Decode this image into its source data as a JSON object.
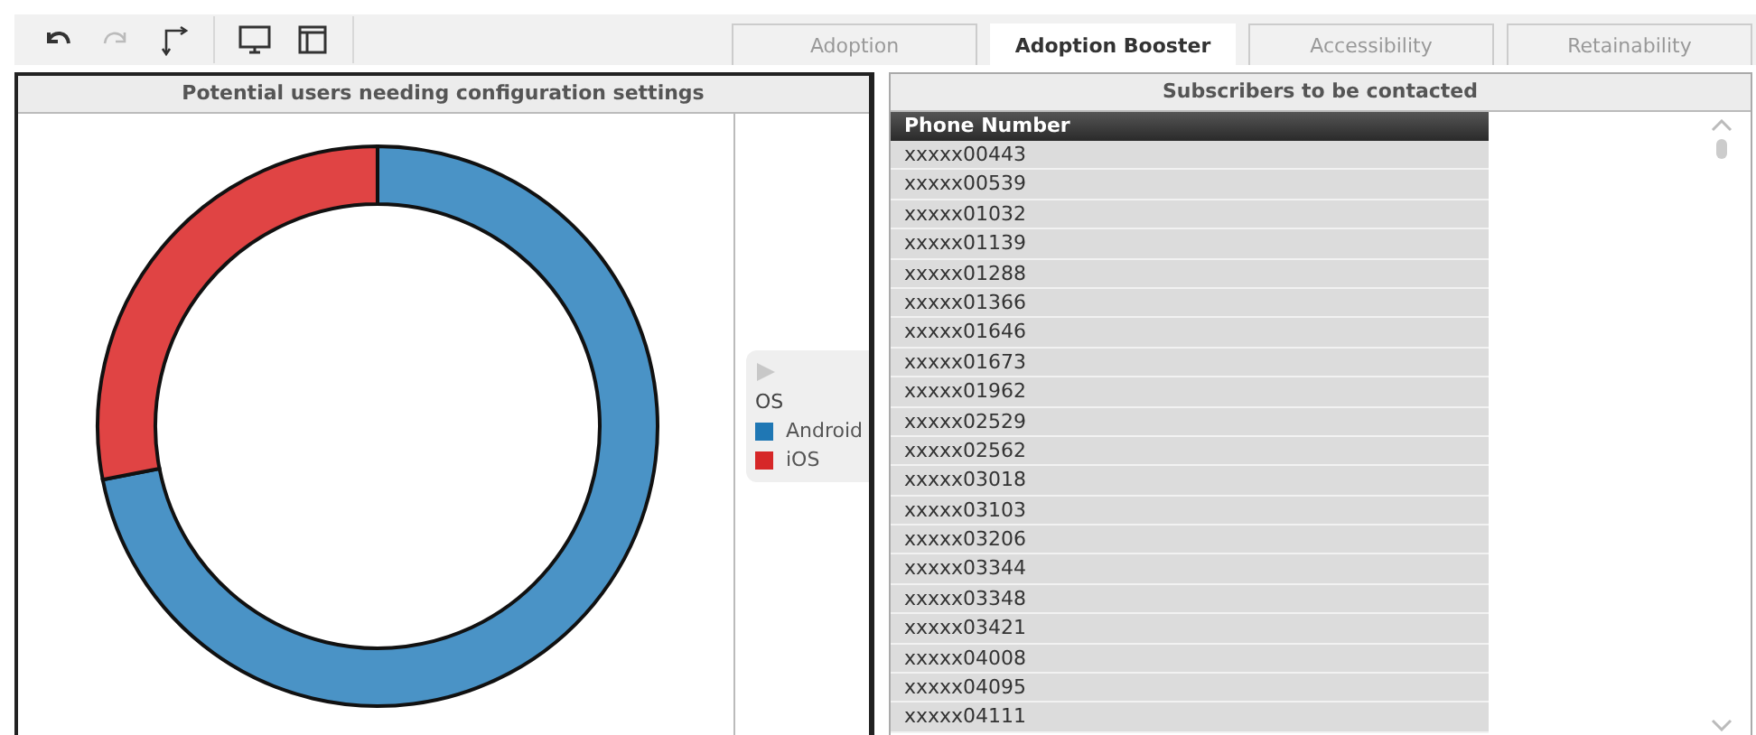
{
  "toolbar": {
    "buttons": [
      {
        "kind": "undo",
        "disabled": false
      },
      {
        "kind": "redo",
        "disabled": true
      },
      {
        "kind": "path",
        "disabled": false
      },
      {
        "kind": "monitor",
        "disabled": false
      },
      {
        "kind": "layout",
        "disabled": false
      }
    ]
  },
  "tabs": [
    {
      "label": "Adoption",
      "selected": false
    },
    {
      "label": "Adoption Booster",
      "selected": true
    },
    {
      "label": "Accessibility",
      "selected": false
    },
    {
      "label": "Retainability",
      "selected": false
    }
  ],
  "left_panel": {
    "title": "Potential users needing configuration settings",
    "legend": {
      "title": "OS",
      "items": [
        {
          "label": "Android",
          "color": "#1f77b4"
        },
        {
          "label": "iOS",
          "color": "#d62728"
        }
      ]
    }
  },
  "right_panel": {
    "title": "Subscribers to be contacted",
    "table": {
      "columns": [
        "Phone Number"
      ],
      "rows": [
        "xxxxx00443",
        "xxxxx00539",
        "xxxxx01032",
        "xxxxx01139",
        "xxxxx01288",
        "xxxxx01366",
        "xxxxx01646",
        "xxxxx01673",
        "xxxxx01962",
        "xxxxx02529",
        "xxxxx02562",
        "xxxxx03018",
        "xxxxx03103",
        "xxxxx03206",
        "xxxxx03344",
        "xxxxx03348",
        "xxxxx03421",
        "xxxxx04008",
        "xxxxx04095",
        "xxxxx04111"
      ]
    }
  }
}
